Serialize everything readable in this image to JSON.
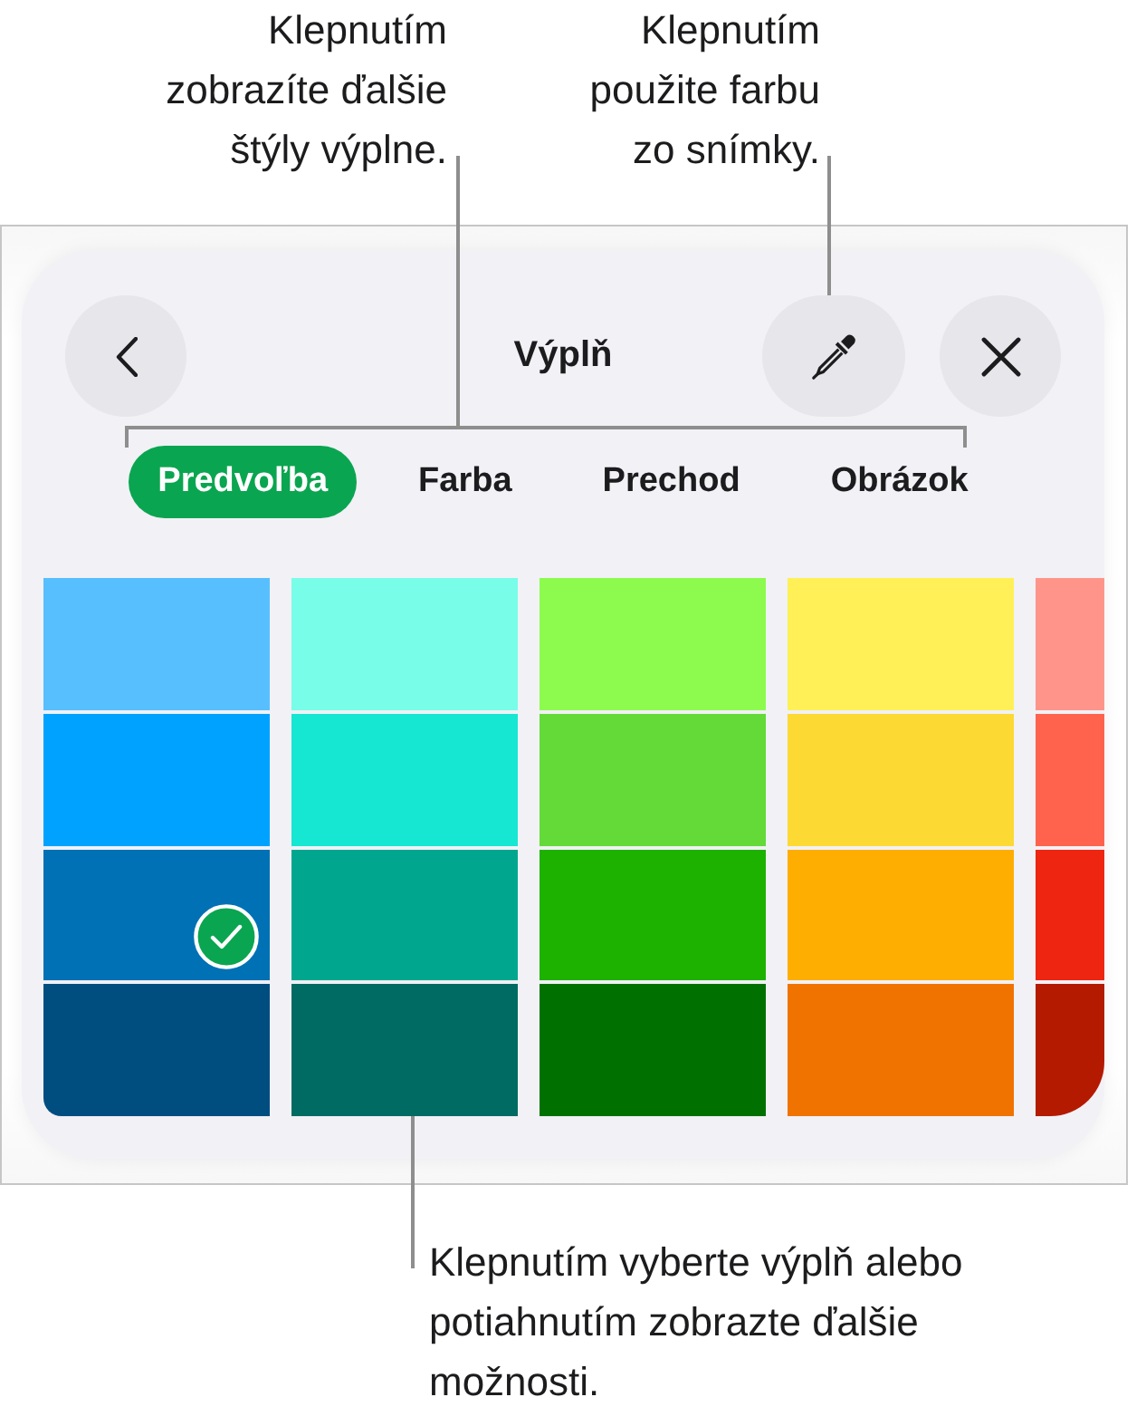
{
  "top_callouts": [
    {
      "lines": [
        "Klepnutím",
        "zobrazíte ďalšie",
        "štýly výplne."
      ]
    },
    {
      "lines": [
        "Klepnutím",
        "použite farbu",
        "zo snímky."
      ]
    }
  ],
  "panel": {
    "title": "Výplň",
    "tabs": [
      {
        "label": "Predvoľba",
        "selected": true
      },
      {
        "label": "Farba",
        "selected": false
      },
      {
        "label": "Prechod",
        "selected": false
      },
      {
        "label": "Obrázok",
        "selected": false
      }
    ],
    "columns": [
      {
        "swatches": [
          {
            "color": "#58bffe",
            "selected": false
          },
          {
            "color": "#00a2ff",
            "selected": false
          },
          {
            "color": "#0071b4",
            "selected": true
          },
          {
            "color": "#004d80",
            "selected": false
          }
        ]
      },
      {
        "swatches": [
          {
            "color": "#78fde9",
            "selected": false
          },
          {
            "color": "#16e7d2",
            "selected": false
          },
          {
            "color": "#00a78e",
            "selected": false
          },
          {
            "color": "#006b62",
            "selected": false
          }
        ]
      },
      {
        "swatches": [
          {
            "color": "#8cfb4e",
            "selected": false
          },
          {
            "color": "#63da38",
            "selected": false
          },
          {
            "color": "#1db200",
            "selected": false
          },
          {
            "color": "#007100",
            "selected": false
          }
        ]
      },
      {
        "swatches": [
          {
            "color": "#fff058",
            "selected": false
          },
          {
            "color": "#fdd933",
            "selected": false
          },
          {
            "color": "#feae00",
            "selected": false
          },
          {
            "color": "#f07300",
            "selected": false
          }
        ]
      },
      {
        "swatches": [
          {
            "color": "#ff958a",
            "selected": false
          },
          {
            "color": "#ff634e",
            "selected": false
          },
          {
            "color": "#ee2511",
            "selected": false
          },
          {
            "color": "#b41a00",
            "selected": false
          }
        ]
      }
    ]
  },
  "bottom_callout": {
    "lines": [
      "Klepnutím vyberte výplň alebo",
      "potiahnutím zobrazte ďalšie",
      "možnosti."
    ]
  }
}
